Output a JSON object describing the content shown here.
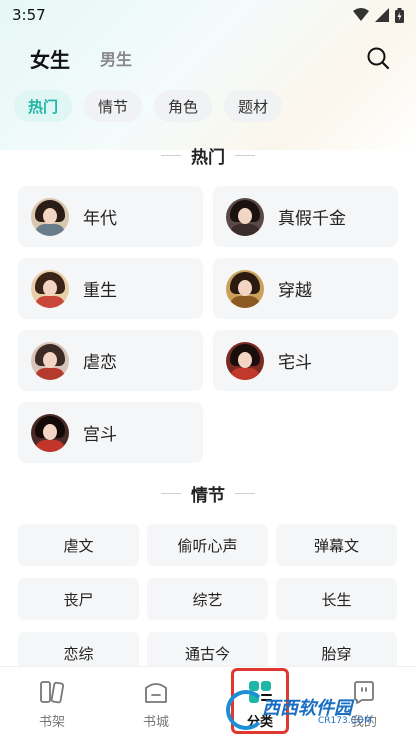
{
  "status_bar": {
    "time": "3:57"
  },
  "header": {
    "tabs": [
      "女生",
      "男生"
    ],
    "search_icon": "search-icon"
  },
  "chips": [
    {
      "label": "热门",
      "active": true
    },
    {
      "label": "情节",
      "active": false
    },
    {
      "label": "角色",
      "active": false
    },
    {
      "label": "题材",
      "active": false
    }
  ],
  "section_hot": {
    "title": "热门",
    "items": [
      "年代",
      "真假千金",
      "重生",
      "穿越",
      "虐恋",
      "宅斗",
      "宫斗"
    ]
  },
  "section_plot": {
    "title": "情节",
    "items": [
      "虐文",
      "偷听心声",
      "弹幕文",
      "丧尸",
      "综艺",
      "长生",
      "恋综",
      "通古今",
      "胎穿"
    ]
  },
  "bottom_nav": [
    {
      "label": "书架",
      "icon": "bookshelf-icon"
    },
    {
      "label": "书城",
      "icon": "bookstore-icon"
    },
    {
      "label": "分类",
      "icon": "category-icon",
      "active": true
    },
    {
      "label": "我的",
      "icon": "profile-icon"
    }
  ],
  "watermark": {
    "brand": "西西软件园",
    "url": "CR173.COM"
  },
  "colors": {
    "accent": "#1fb6a6",
    "highlight": "#e0382e"
  }
}
